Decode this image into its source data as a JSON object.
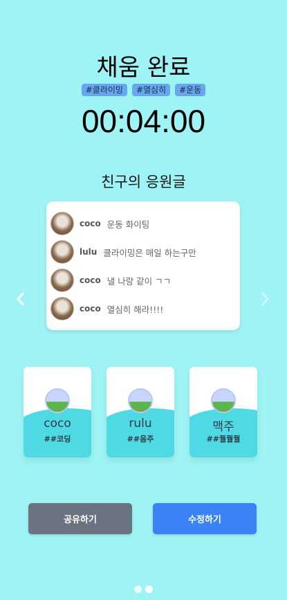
{
  "header": {
    "title": "채움 완료",
    "tags": [
      "#클라이밍",
      "#열심히",
      "#운동"
    ],
    "timer": "00:04:00"
  },
  "comments_section": {
    "title": "친구의 응원글",
    "items": [
      {
        "name": "coco",
        "text": "운동 화이팅"
      },
      {
        "name": "lulu",
        "text": "클라이밍은 매일 하는구만"
      },
      {
        "name": "coco",
        "text": "낼 나랑 같이 ㄱㄱ"
      },
      {
        "name": "coco",
        "text": "열심히 해라!!!!"
      }
    ]
  },
  "nav": {
    "prev_icon": "chevron-left-icon",
    "next_icon": "chevron-right-icon"
  },
  "friends": [
    {
      "name": "coco",
      "tag": "##코딩"
    },
    {
      "name": "rulu",
      "tag": "##음주"
    },
    {
      "name": "맥주",
      "tag": "##꿜꿜꿜"
    }
  ],
  "buttons": {
    "share": "공유하기",
    "edit": "수정하기"
  },
  "pagination": {
    "total": 2,
    "current": 2
  },
  "colors": {
    "background": "#9ef4f5",
    "tag": "#66a8f0",
    "share": "#6b7280",
    "edit": "#3b82f6",
    "card_wave": "#4fd9e3"
  }
}
